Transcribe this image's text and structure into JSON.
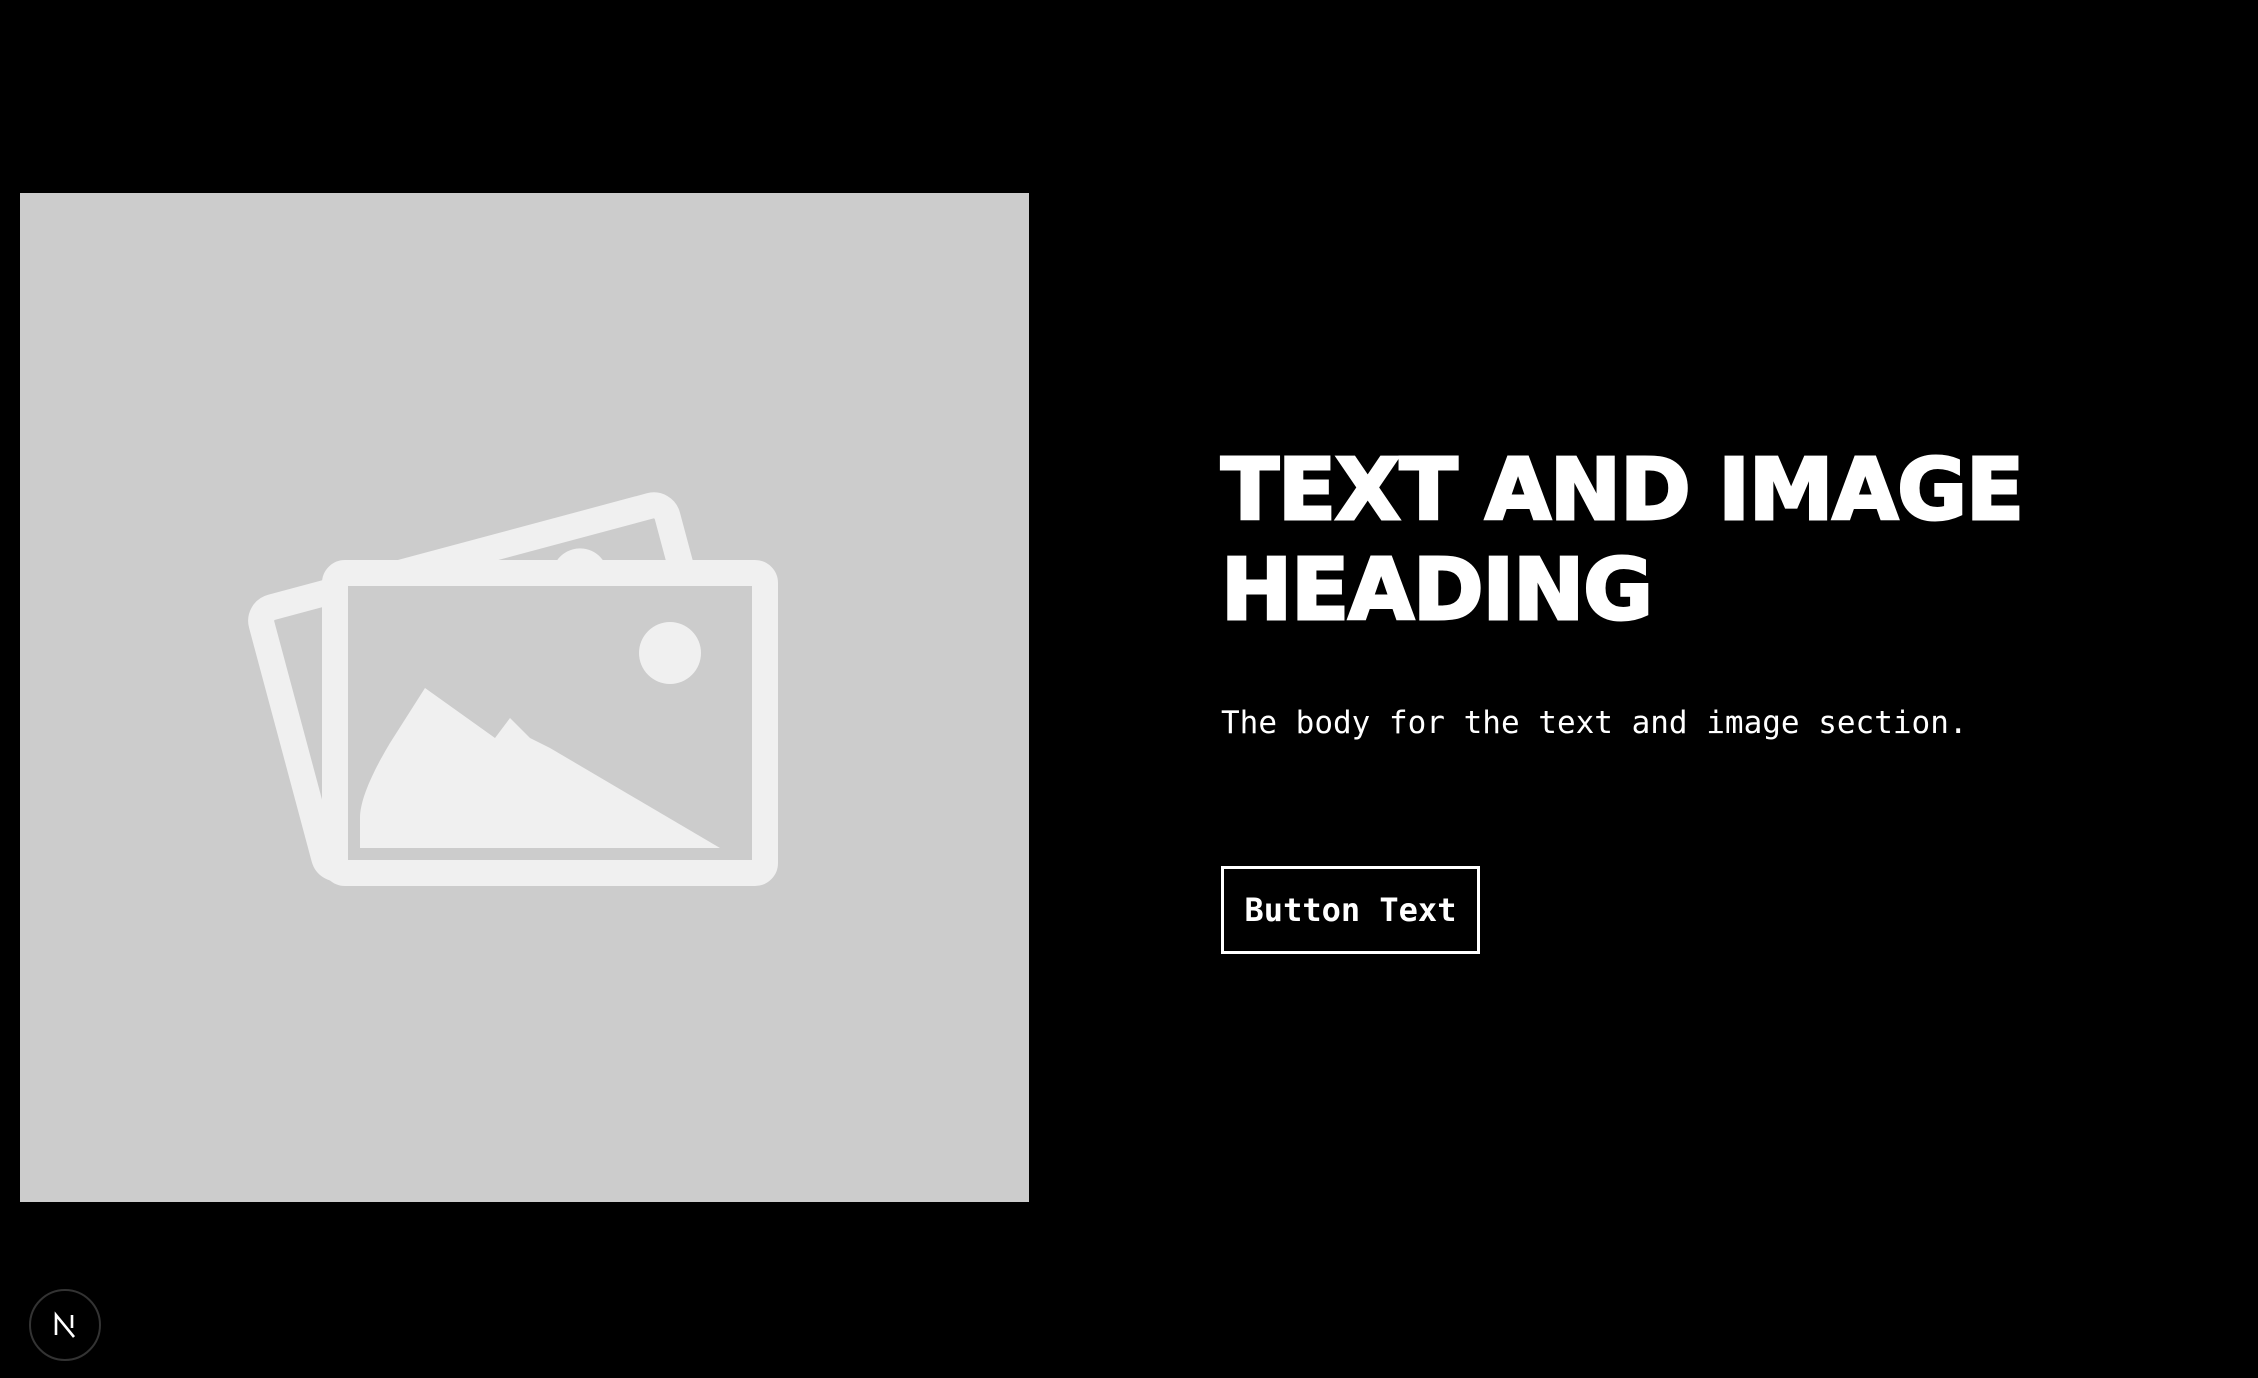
{
  "section": {
    "heading": "TEXT AND IMAGE HEADING",
    "body": "The body for the text and image section.",
    "button_label": "Button Text"
  },
  "image": {
    "icon": "image-placeholder-icon",
    "background_color": "#cccccc",
    "icon_color": "#f0f0f0"
  },
  "badge": {
    "icon": "nextjs-logo-icon"
  },
  "colors": {
    "background": "#000000",
    "text": "#ffffff"
  }
}
